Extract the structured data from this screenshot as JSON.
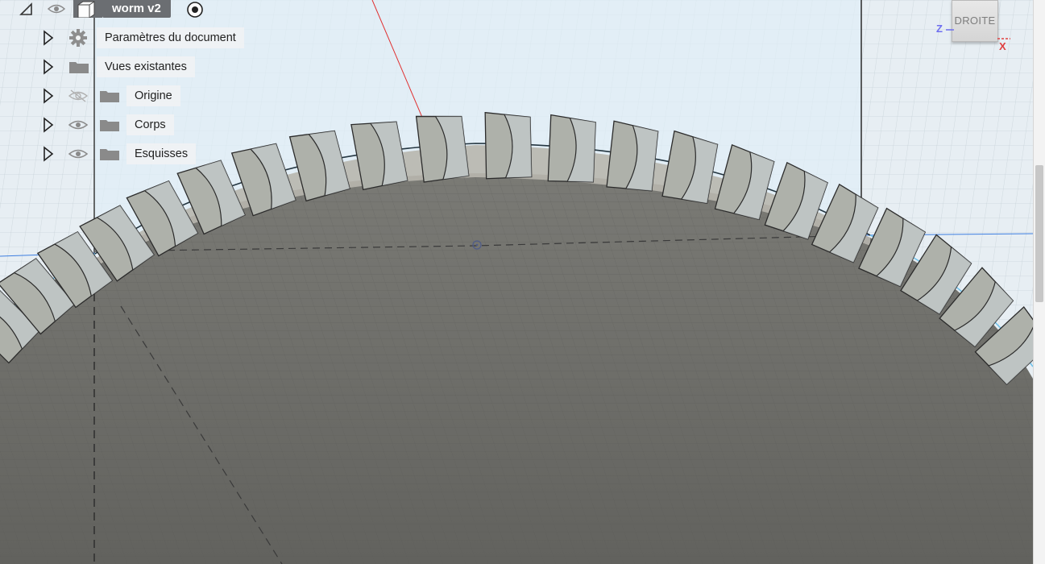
{
  "browser": {
    "root": {
      "label": "worm v2",
      "expanded": true,
      "visible": true,
      "active": true
    },
    "items": [
      {
        "label": "Paramètres du document",
        "icon": "gear-icon",
        "visibility": "none"
      },
      {
        "label": "Vues existantes",
        "icon": "folder-icon",
        "visibility": "none"
      },
      {
        "label": "Origine",
        "icon": "folder-icon",
        "visibility": "hidden"
      },
      {
        "label": "Corps",
        "icon": "folder-icon",
        "visibility": "visible"
      },
      {
        "label": "Esquisses",
        "icon": "folder-icon",
        "visibility": "visible"
      }
    ]
  },
  "viewcube": {
    "face_label": "DROITE",
    "axis_z": "Z",
    "axis_x": "X"
  },
  "colors": {
    "sky_grid": "#e4edf3",
    "gear_face": "#6c6c68",
    "tooth": "#a9aca6",
    "axis_red": "#e03030",
    "axis_blue": "#3d7ee0",
    "axis_cyan": "#5ab8e6"
  }
}
